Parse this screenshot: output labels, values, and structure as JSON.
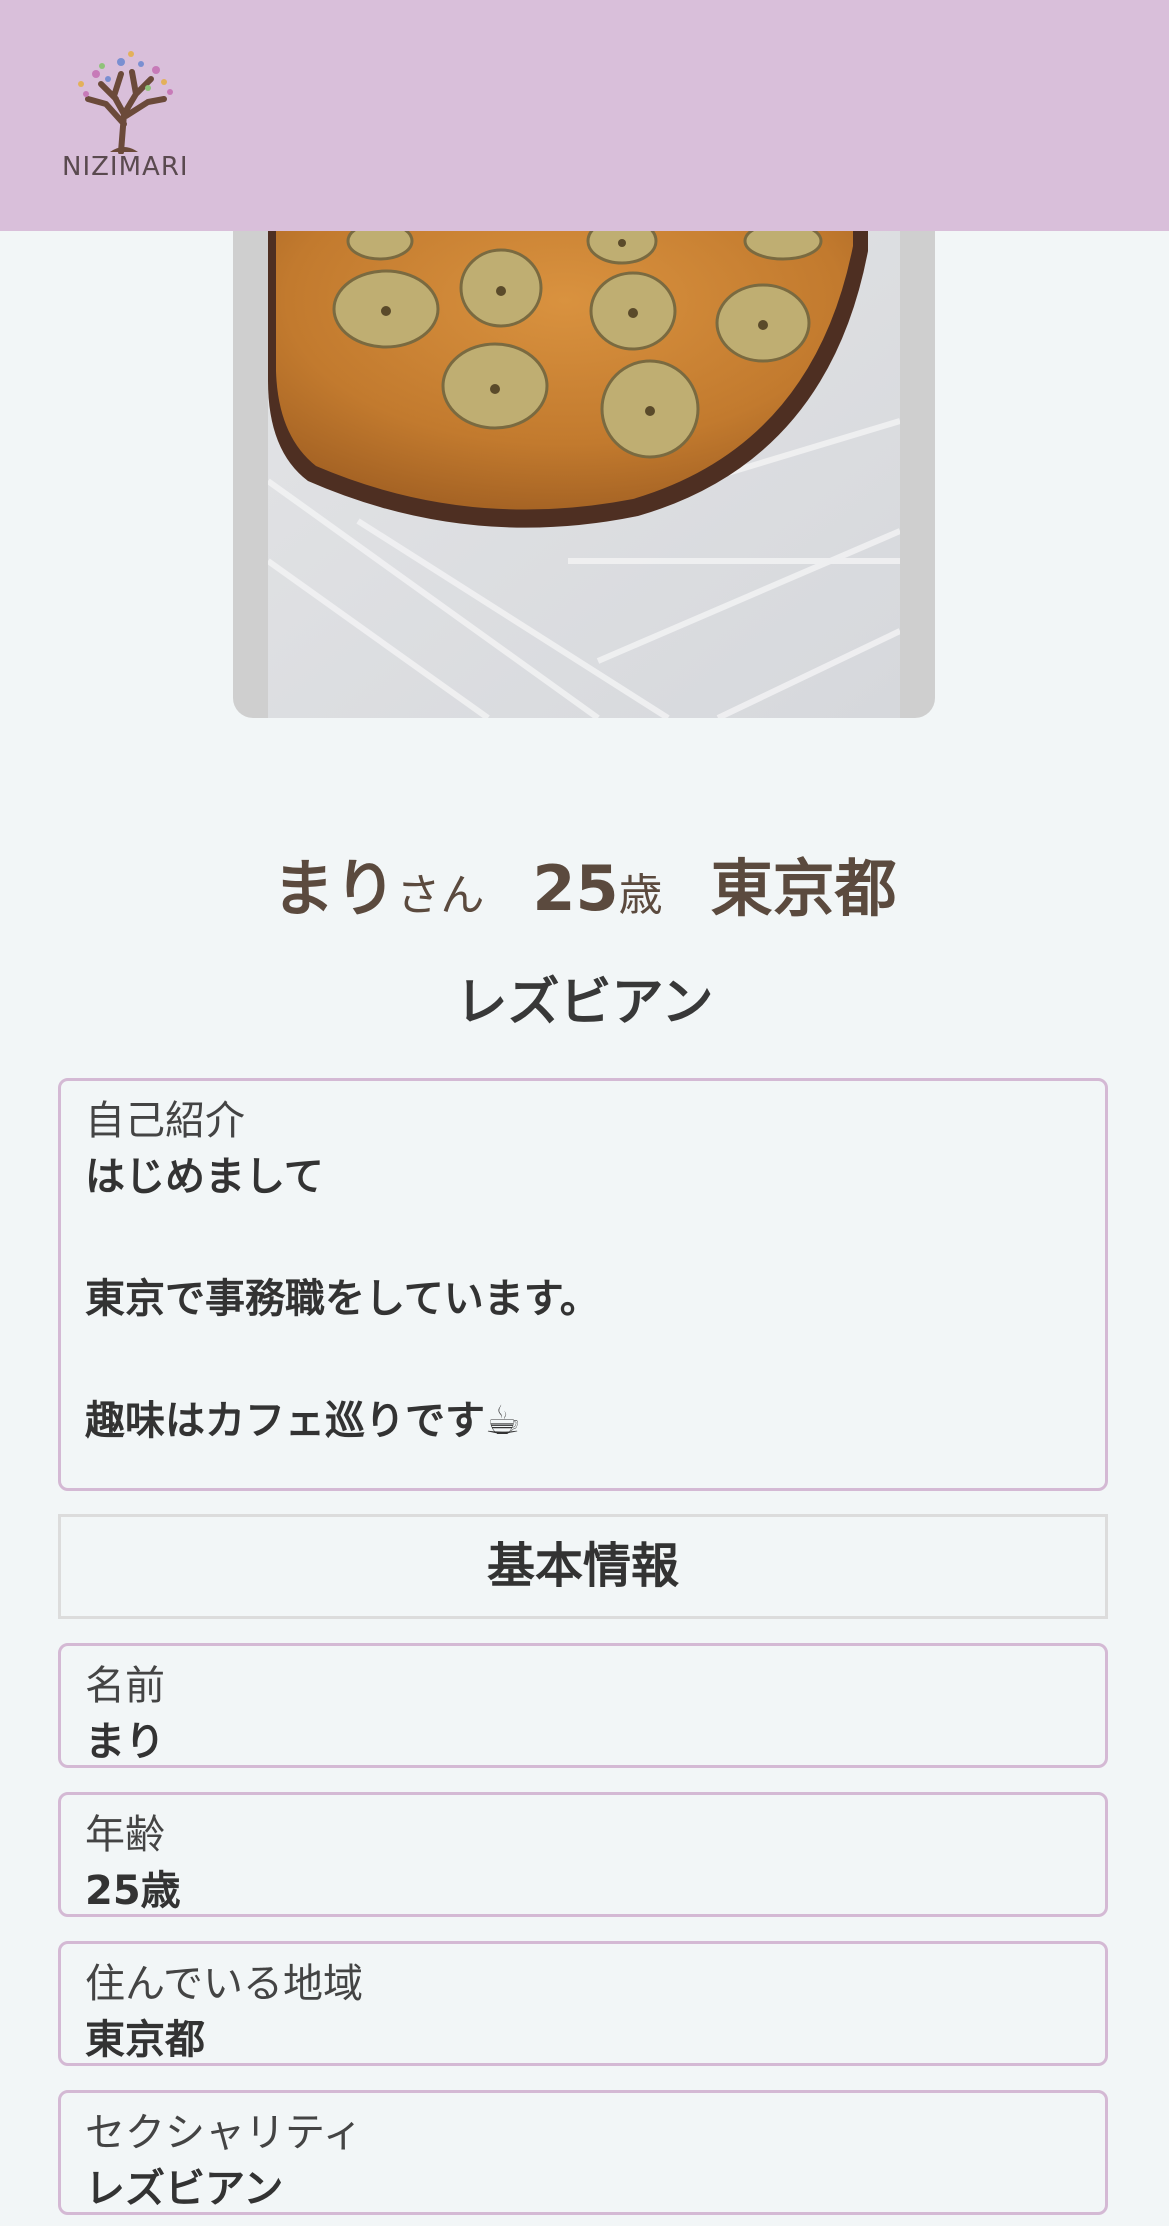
{
  "header": {
    "logo_text": "NIZIMARI",
    "background_color": "#d9bfda"
  },
  "profile": {
    "name": "まり",
    "honorific": "さん",
    "age_number": "25",
    "age_unit": "歳",
    "location": "東京都",
    "sexuality": "レズビアン"
  },
  "intro": {
    "label": "自己紹介",
    "lines": [
      "はじめまして",
      "",
      "東京で事務職をしています。",
      "",
      "趣味はカフェ巡りです☕"
    ]
  },
  "basic_info": {
    "title": "基本情報",
    "fields": [
      {
        "label": "名前",
        "value": "まり"
      },
      {
        "label": "年齢",
        "value": "25歳"
      },
      {
        "label": "住んでいる地域",
        "value": "東京都"
      },
      {
        "label": "セクシャリティ",
        "value": "レズビアン"
      }
    ]
  },
  "icons": {
    "logo": "tree-logo-icon",
    "photo": "banana-tart-photo"
  },
  "colors": {
    "accent_border": "#d4b9d4",
    "page_background": "#f2f6f7",
    "headline_text": "#5b4a3e"
  }
}
